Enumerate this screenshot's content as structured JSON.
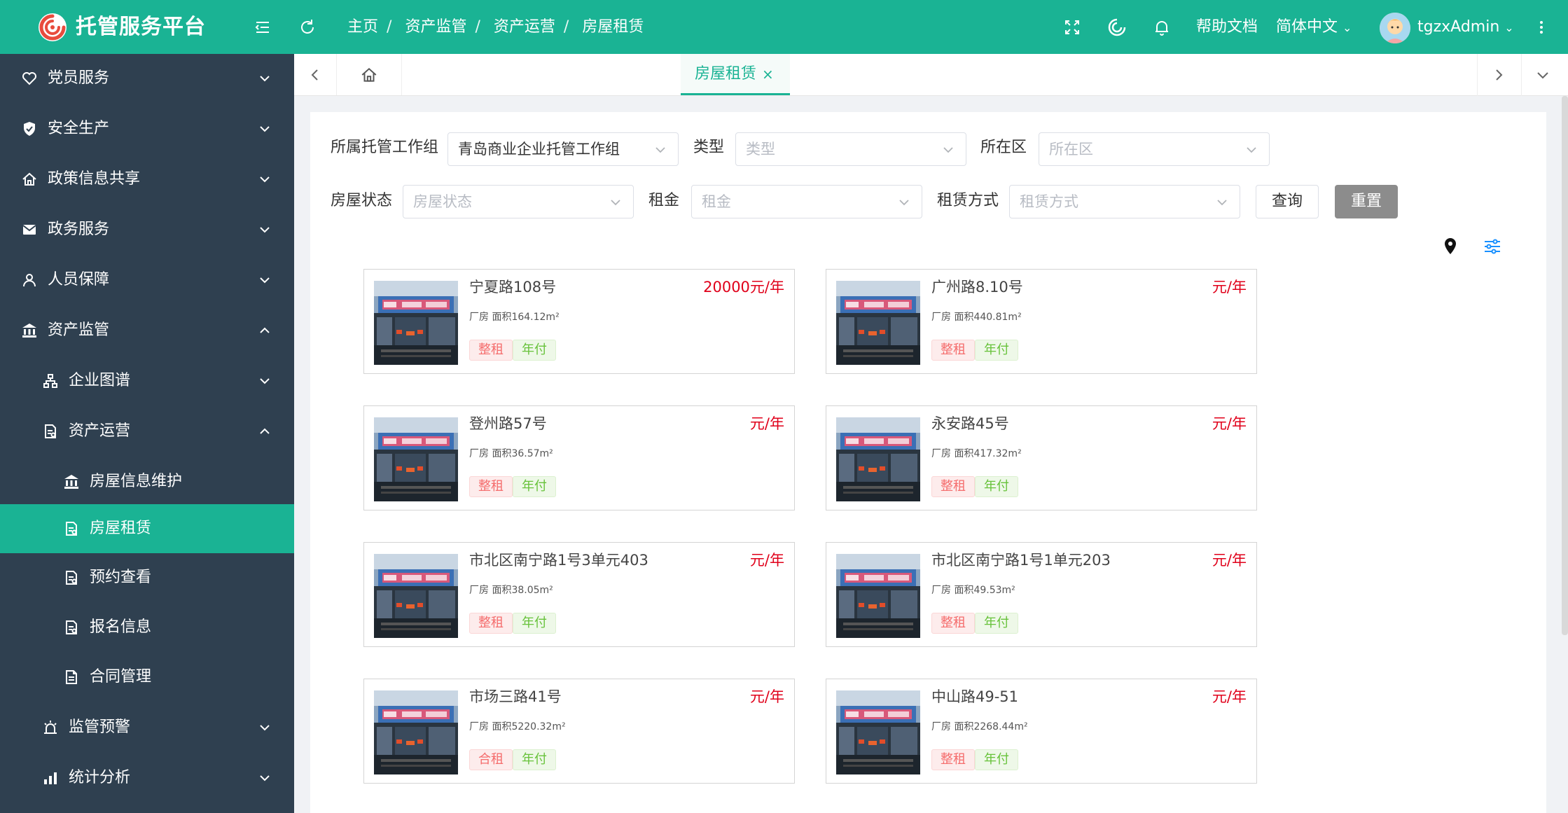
{
  "header": {
    "app_title": "托管服务平台",
    "breadcrumb": [
      "主页",
      "资产监管",
      "资产运营",
      "房屋租赁"
    ],
    "help_label": "帮助文档",
    "language_label": "简体中文",
    "username": "tgzxAdmin"
  },
  "sidebar": {
    "items": [
      {
        "label": "党员服务",
        "icon": "heart-icon",
        "expanded": false
      },
      {
        "label": "安全生产",
        "icon": "shield-icon",
        "expanded": false
      },
      {
        "label": "政策信息共享",
        "icon": "home-icon",
        "expanded": false
      },
      {
        "label": "政务服务",
        "icon": "mail-icon",
        "expanded": false
      },
      {
        "label": "人员保障",
        "icon": "user-icon",
        "expanded": false
      },
      {
        "label": "资产监管",
        "icon": "bank-icon",
        "expanded": true
      },
      {
        "label": "企业图谱",
        "icon": "org-chart-icon",
        "expanded": false
      },
      {
        "label": "资产运营",
        "icon": "document-icon",
        "expanded": true
      },
      {
        "label": "房屋信息维护",
        "icon": "bank-icon"
      },
      {
        "label": "房屋租赁",
        "icon": "document-icon",
        "active": true
      },
      {
        "label": "预约查看",
        "icon": "document-icon"
      },
      {
        "label": "报名信息",
        "icon": "document-icon"
      },
      {
        "label": "合同管理",
        "icon": "file-icon"
      },
      {
        "label": "监管预警",
        "icon": "alarm-icon",
        "expanded": false
      },
      {
        "label": "统计分析",
        "icon": "bar-chart-icon",
        "expanded": false
      }
    ]
  },
  "tabs": {
    "active_label": "房屋租赁",
    "close_glyph": "×"
  },
  "filters": {
    "group": {
      "label": "所属托管工作组",
      "value": "青岛商业企业托管工作组"
    },
    "type": {
      "label": "类型",
      "placeholder": "类型"
    },
    "district": {
      "label": "所在区",
      "placeholder": "所在区"
    },
    "status": {
      "label": "房屋状态",
      "placeholder": "房屋状态"
    },
    "rent": {
      "label": "租金",
      "placeholder": "租金"
    },
    "lease_mode": {
      "label": "租赁方式",
      "placeholder": "租赁方式"
    },
    "query_label": "查询",
    "reset_label": "重置"
  },
  "listings": [
    {
      "title": "宁夏路108号",
      "price": "20000元/年",
      "info": "厂房 面积164.12m²",
      "tag1": "整租",
      "tag2": "年付"
    },
    {
      "title": "广州路8.10号",
      "price": "元/年",
      "info": "厂房 面积440.81m²",
      "tag1": "整租",
      "tag2": "年付"
    },
    {
      "title": "登州路57号",
      "price": "元/年",
      "info": "厂房 面积36.57m²",
      "tag1": "整租",
      "tag2": "年付"
    },
    {
      "title": "永安路45号",
      "price": "元/年",
      "info": "厂房 面积417.32m²",
      "tag1": "整租",
      "tag2": "年付"
    },
    {
      "title": "市北区南宁路1号3单元403",
      "price": "元/年",
      "info": "厂房 面积38.05m²",
      "tag1": "整租",
      "tag2": "年付"
    },
    {
      "title": "市北区南宁路1号1单元203",
      "price": "元/年",
      "info": "厂房 面积49.53m²",
      "tag1": "整租",
      "tag2": "年付"
    },
    {
      "title": "市场三路41号",
      "price": "元/年",
      "info": "厂房 面积5220.32m²",
      "tag1": "合租",
      "tag2": "年付"
    },
    {
      "title": "中山路49-51",
      "price": "元/年",
      "info": "厂房 面积2268.44m²",
      "tag1": "整租",
      "tag2": "年付"
    }
  ],
  "colors": {
    "brand": "#1ab394",
    "sidebar_bg": "#2f4050",
    "price_red": "#e0001a"
  }
}
